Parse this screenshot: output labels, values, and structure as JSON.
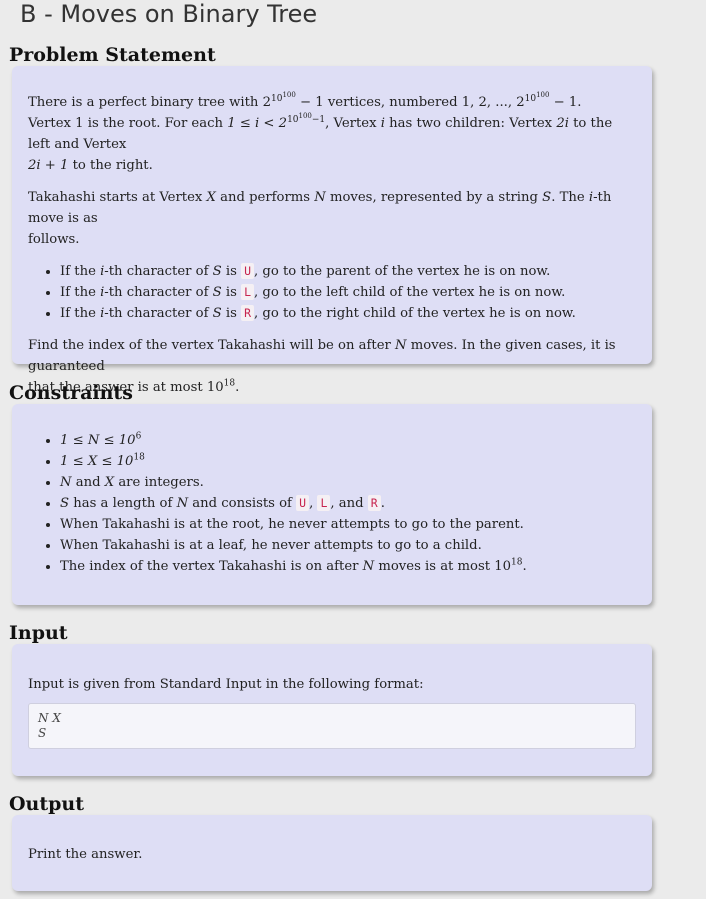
{
  "title": "B - Moves on Binary Tree",
  "sections": {
    "problem": "Problem Statement",
    "constraints": "Constraints",
    "input": "Input",
    "output": "Output"
  },
  "statement": {
    "p1_a": "There is a perfect binary tree with ",
    "p1_math1": "2",
    "p1_math1_sup": "10",
    "p1_math1_supsup": "100",
    "p1_b": " − 1",
    "p1_c": " vertices, numbered ",
    "p1_d": "1, 2, ..., 2",
    "p1_e": " − 1",
    "p1_f": ".",
    "p2_a": "Vertex ",
    "p2_one": "1",
    "p2_b": " is the root. For each ",
    "p2_cond": "1 ≤ i < 2",
    "p2_cond_sup": "10",
    "p2_cond_supsup": "100",
    "p2_cond_tail": "−1",
    "p2_c": ", Vertex ",
    "p2_i": "i",
    "p2_d": " has two children: Vertex ",
    "p2_2i": "2i",
    "p2_e": " to the left and Vertex",
    "p3_2i1": "2i + 1",
    "p3_a": " to the right.",
    "p4_a": "Takahashi starts at Vertex ",
    "p4_X": "X",
    "p4_b": " and performs ",
    "p4_N": "N",
    "p4_c": " moves, represented by a string ",
    "p4_S": "S",
    "p4_d": ". The ",
    "p4_i": "i",
    "p4_e": "-th move is as",
    "p5_a": "follows.",
    "b1_a": "If the ",
    "b_i": "i",
    "b1_b": "-th character of ",
    "b_S": "S",
    "b1_c": " is ",
    "b1_code": "U",
    "b1_d": ", go to the parent of the vertex he is on now.",
    "b2_code": "L",
    "b2_d": ", go to the left child of the vertex he is on now.",
    "b3_code": "R",
    "b3_d": ", go to the right child of the vertex he is on now.",
    "p6_a": "Find the index of the vertex Takahashi will be on after ",
    "p6_N": "N",
    "p6_b": " moves. In the given cases, it is guaranteed",
    "p7_a": "that the answer is at most ",
    "p7_num": "10",
    "p7_sup": "18",
    "p7_b": "."
  },
  "constraints": {
    "c1": "1 ≤ N ≤ 10",
    "c1_sup": "6",
    "c2": "1 ≤ X ≤ 10",
    "c2_sup": "18",
    "c3_N": "N",
    "c3_a": " and ",
    "c3_X": "X",
    "c3_b": " are integers.",
    "c4_S": "S",
    "c4_a": " has a length of ",
    "c4_N": "N",
    "c4_b": " and consists of ",
    "c4_U": "U",
    "c4_c": ", ",
    "c4_L": "L",
    "c4_d": ", and ",
    "c4_R": "R",
    "c4_e": ".",
    "c5": "When Takahashi is at the root, he never attempts to go to the parent.",
    "c6": "When Takahashi is at a leaf, he never attempts to go to a child.",
    "c7_a": "The index of the vertex Takahashi is on after ",
    "c7_N": "N",
    "c7_b": " moves is at most ",
    "c7_num": "10",
    "c7_sup": "18",
    "c7_c": "."
  },
  "input": {
    "text": "Input is given from Standard Input in the following format:",
    "line1": "N X",
    "line2": "S"
  },
  "output": {
    "text": "Print the answer."
  }
}
